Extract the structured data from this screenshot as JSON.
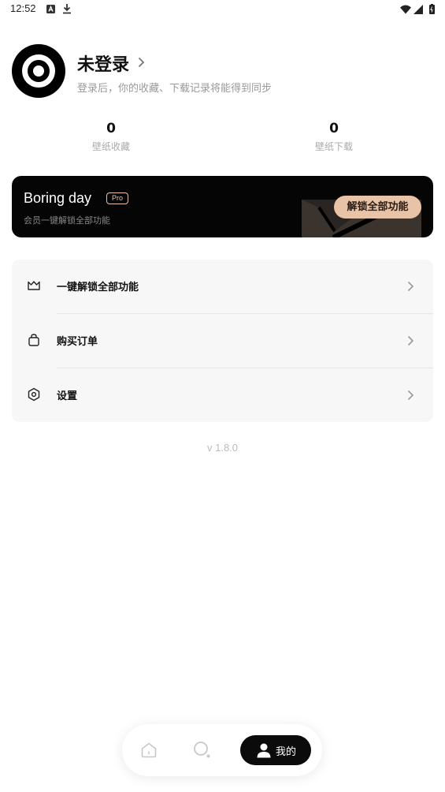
{
  "status_bar": {
    "time": "12:52",
    "icons": [
      "a-badge-icon",
      "download-icon",
      "wifi-icon",
      "signal-icon",
      "battery-icon"
    ]
  },
  "profile": {
    "name": "未登录",
    "subtitle": "登录后，你的收藏、下载记录将能得到同步"
  },
  "stats": {
    "favorites": {
      "value": "0",
      "label": "壁纸收藏"
    },
    "downloads": {
      "value": "0",
      "label": "壁纸下载"
    }
  },
  "pro_banner": {
    "title": "Boring day",
    "badge": "Pro",
    "subtitle": "会员一键解锁全部功能",
    "button_label": "解锁全部功能",
    "accent_color": "#e8c3a8"
  },
  "menu": {
    "items": [
      {
        "label": "一键解锁全部功能",
        "icon": "crown-icon"
      },
      {
        "label": "购买订单",
        "icon": "shopping-bag-icon"
      },
      {
        "label": "设置",
        "icon": "settings-hexagon-icon"
      }
    ]
  },
  "version": "v 1.8.0",
  "bottom_nav": {
    "items": [
      {
        "id": "home",
        "icon": "home-icon",
        "active": false
      },
      {
        "id": "search",
        "icon": "search-icon",
        "active": false
      },
      {
        "id": "me",
        "icon": "user-icon",
        "label": "我的",
        "active": true
      }
    ]
  }
}
